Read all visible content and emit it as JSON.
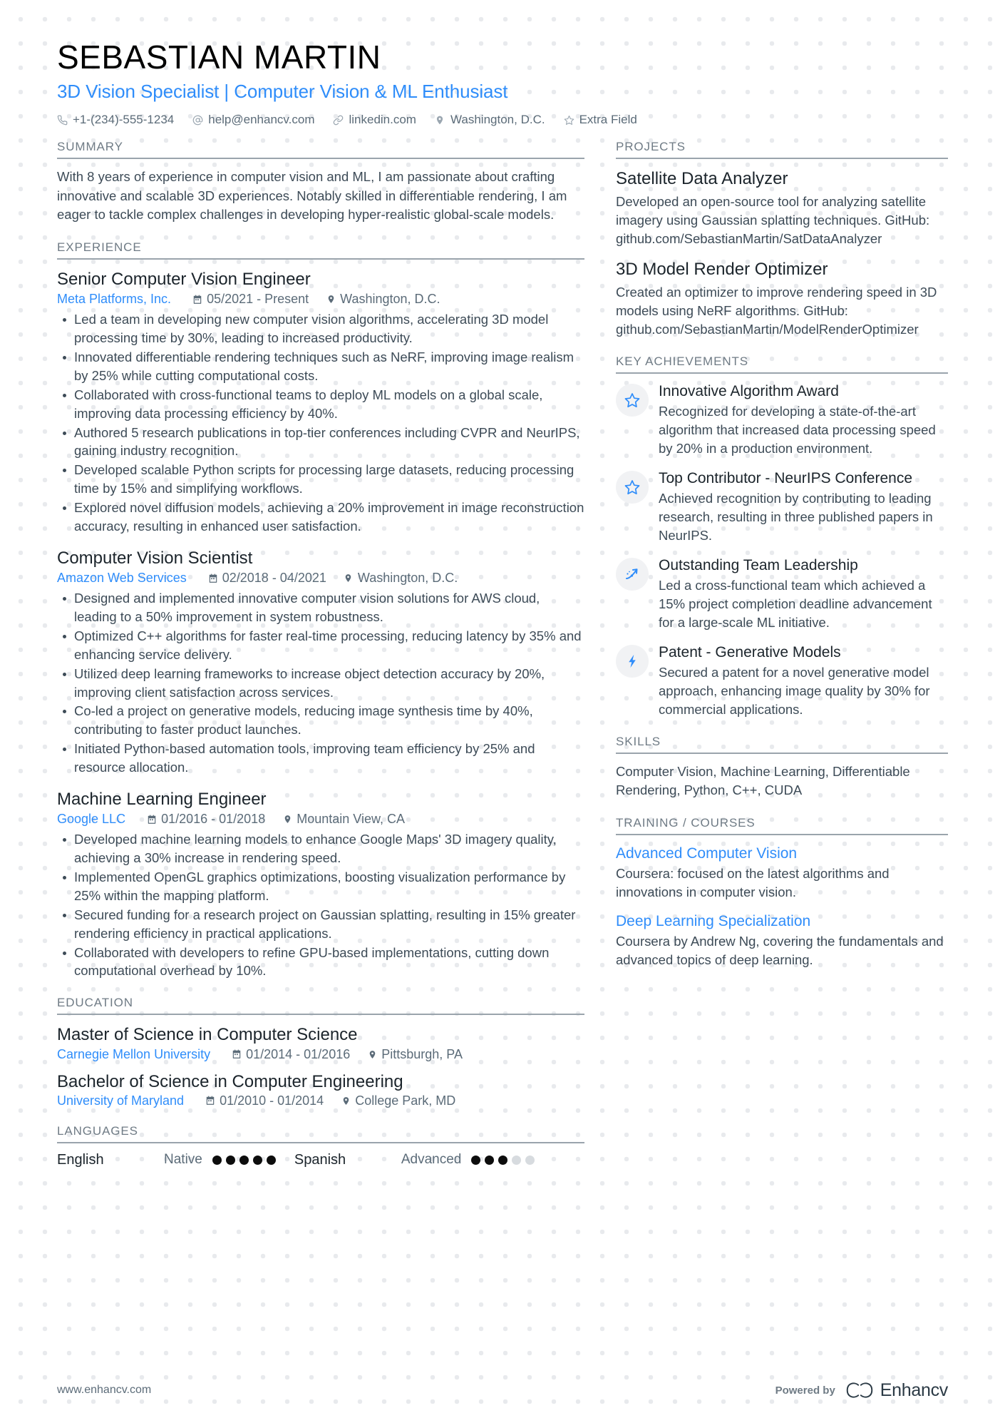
{
  "colors": {
    "accent": "#2f8dfa",
    "heading": "#1b242b",
    "body": "#3d4b57",
    "muted": "#6f7b85",
    "rule": "#9aa4ac"
  },
  "header": {
    "name": "SEBASTIAN MARTIN",
    "job_title": "3D Vision Specialist | Computer Vision & ML Enthusiast",
    "contacts": [
      {
        "icon": "phone-icon",
        "text": "+1-(234)-555-1234"
      },
      {
        "icon": "email-icon",
        "text": "help@enhancv.com"
      },
      {
        "icon": "link-icon",
        "text": "linkedin.com"
      },
      {
        "icon": "location-icon",
        "text": "Washington, D.C."
      },
      {
        "icon": "star-icon",
        "text": "Extra Field"
      }
    ]
  },
  "left": {
    "summary": {
      "title": "SUMMARY",
      "text": "With 8 years of experience in computer vision and ML, I am passionate about crafting innovative and scalable 3D experiences. Notably skilled in differentiable rendering, I am eager to tackle complex challenges in developing hyper-realistic global-scale models."
    },
    "experience": {
      "title": "EXPERIENCE",
      "entries": [
        {
          "role": "Senior Computer Vision Engineer",
          "company": "Meta Platforms, Inc.",
          "dates": "05/2021 - Present",
          "location": "Washington, D.C.",
          "bullets": [
            "Led a team in developing new computer vision algorithms, accelerating 3D model processing time by 30%, leading to increased productivity.",
            "Innovated differentiable rendering techniques such as NeRF, improving image realism by 25% while cutting computational costs.",
            "Collaborated with cross-functional teams to deploy ML models on a global scale, improving data processing efficiency by 40%.",
            "Authored 5 research publications in top-tier conferences including CVPR and NeurIPS, gaining industry recognition.",
            "Developed scalable Python scripts for processing large datasets, reducing processing time by 15% and simplifying workflows.",
            "Explored novel diffusion models, achieving a 20% improvement in image reconstruction accuracy, resulting in enhanced user satisfaction."
          ]
        },
        {
          "role": "Computer Vision Scientist",
          "company": "Amazon Web Services",
          "dates": "02/2018 - 04/2021",
          "location": "Washington, D.C.",
          "bullets": [
            "Designed and implemented innovative computer vision solutions for AWS cloud, leading to a 50% improvement in system robustness.",
            "Optimized C++ algorithms for faster real-time processing, reducing latency by 35% and enhancing service delivery.",
            "Utilized deep learning frameworks to increase object detection accuracy by 20%, improving client satisfaction across services.",
            "Co-led a project on generative models, reducing image synthesis time by 40%, contributing to faster product launches.",
            "Initiated Python-based automation tools, improving team efficiency by 25% and resource allocation."
          ]
        },
        {
          "role": "Machine Learning Engineer",
          "company": "Google LLC",
          "dates": "01/2016 - 01/2018",
          "location": "Mountain View, CA",
          "bullets": [
            "Developed machine learning models to enhance Google Maps' 3D imagery quality, achieving a 30% increase in rendering speed.",
            "Implemented OpenGL graphics optimizations, boosting visualization performance by 25% within the mapping platform.",
            "Secured funding for a research project on Gaussian splatting, resulting in 15% greater rendering efficiency in practical applications.",
            "Collaborated with developers to refine GPU-based implementations, cutting down computational overhead by 10%."
          ]
        }
      ]
    },
    "education": {
      "title": "EDUCATION",
      "entries": [
        {
          "degree": "Master of Science in Computer Science",
          "school": "Carnegie Mellon University",
          "dates": "01/2014 - 01/2016",
          "location": "Pittsburgh, PA"
        },
        {
          "degree": "Bachelor of Science in Computer Engineering",
          "school": "University of Maryland",
          "dates": "01/2010 - 01/2014",
          "location": "College Park, MD"
        }
      ]
    },
    "languages": {
      "title": "LANGUAGES",
      "items": [
        {
          "name": "English",
          "level": "Native",
          "filled": 5,
          "total": 5
        },
        {
          "name": "Spanish",
          "level": "Advanced",
          "filled": 3,
          "total": 5
        }
      ]
    }
  },
  "right": {
    "projects": {
      "title": "PROJECTS",
      "entries": [
        {
          "name": "Satellite Data Analyzer",
          "desc": "Developed an open-source tool for analyzing satellite imagery using Gaussian splatting techniques. GitHub: github.com/SebastianMartin/SatDataAnalyzer"
        },
        {
          "name": "3D Model Render Optimizer",
          "desc": "Created an optimizer to improve rendering speed in 3D models using NeRF algorithms. GitHub: github.com/SebastianMartin/ModelRenderOptimizer"
        }
      ]
    },
    "achievements": {
      "title": "KEY ACHIEVEMENTS",
      "items": [
        {
          "icon": "star-icon",
          "title": "Innovative Algorithm Award",
          "desc": "Recognized for developing a state-of-the-art algorithm that increased data processing speed by 20% in a production environment."
        },
        {
          "icon": "star-icon",
          "title": "Top Contributor - NeurIPS Conference",
          "desc": "Achieved recognition by contributing to leading research, resulting in three published papers in NeurIPS."
        },
        {
          "icon": "trending-up-icon",
          "title": "Outstanding Team Leadership",
          "desc": "Led a cross-functional team which achieved a 15% project completion deadline advancement for a large-scale ML initiative."
        },
        {
          "icon": "lightning-bolt-icon",
          "title": "Patent - Generative Models",
          "desc": "Secured a patent for a novel generative model approach, enhancing image quality by 30% for commercial applications."
        }
      ]
    },
    "skills": {
      "title": "SKILLS",
      "text": "Computer Vision, Machine Learning, Differentiable Rendering, Python, C++, CUDA"
    },
    "training": {
      "title": "TRAINING / COURSES",
      "entries": [
        {
          "name": "Advanced Computer Vision",
          "desc": "Coursera: focused on the latest algorithms and innovations in computer vision."
        },
        {
          "name": "Deep Learning Specialization",
          "desc": "Coursera by Andrew Ng, covering the fundamentals and advanced topics of deep learning."
        }
      ]
    }
  },
  "footer": {
    "url": "www.enhancv.com",
    "powered_by": "Powered by",
    "brand": "Enhancv"
  }
}
